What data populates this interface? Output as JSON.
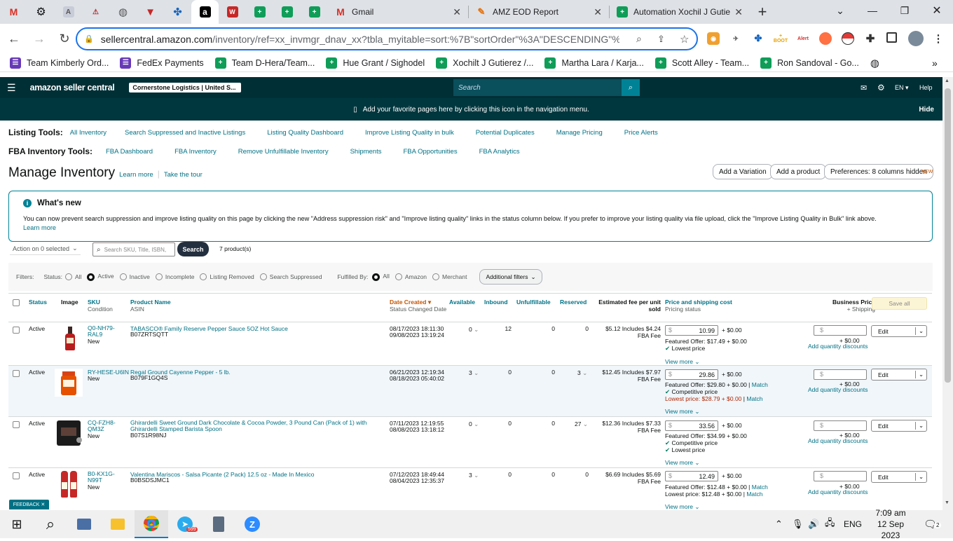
{
  "browser": {
    "pinned_tabs": [
      "gmail",
      "chatgpt",
      "ext-a",
      "ext-b",
      "globe",
      "v-shield",
      "diamond",
      "amazon",
      "wm",
      "sheets",
      "sheets",
      "sheets"
    ],
    "tabs": [
      {
        "title": "Gmail"
      },
      {
        "title": "AMZ EOD Report"
      },
      {
        "title": "Automation Xochil J Gutie"
      }
    ],
    "url": "sellercentral.amazon.com",
    "url_rest": "/inventory/ref=xx_invmgr_dnav_xx?tbla_myitable=sort:%7B\"sortOrder\"%3A\"DESCENDING\"%2C...",
    "bookmarks": [
      "Team Kimberly Ord...",
      "FedEx Payments",
      "Team D-Hera/Team...",
      "Hue Grant / Sighodel",
      "Xochilt J Gutierez /...",
      "Martha Lara / Karja...",
      "Scott Alley - Team...",
      "Ron Sandoval - Go..."
    ],
    "ext_labels": {
      "boot": "BOOT",
      "alert": "Alert"
    }
  },
  "seller": {
    "logo": "amazon seller central",
    "account": "Cornerstone Logistics | United S...",
    "search_placeholder": "Search",
    "lang": "EN",
    "help": "Help",
    "nav_hint": "Add your favorite pages here by clicking this icon in the navigation menu.",
    "hide": "Hide"
  },
  "tools": {
    "listing_label": "Listing Tools:",
    "listing": [
      "All Inventory",
      "Search Suppressed and Inactive Listings",
      "Listing Quality Dashboard",
      "Improve Listing Quality in bulk",
      "Potential Duplicates",
      "Manage Pricing",
      "Price Alerts"
    ],
    "fba_label": "FBA Inventory Tools:",
    "fba": [
      "FBA Dashboard",
      "FBA Inventory",
      "Remove Unfulfillable Inventory",
      "Shipments",
      "FBA Opportunities",
      "FBA Analytics"
    ]
  },
  "page": {
    "title": "Manage Inventory",
    "learn_more": "Learn more",
    "tour": "Take the tour",
    "add_variation": "Add a Variation",
    "add_product": "Add a product",
    "preferences": "Preferences: 8 columns hidden",
    "new_badge": "NEW"
  },
  "whats_new": {
    "title": "What's new",
    "body": "You can now prevent search suppression and improve listing quality on this page by clicking the new \"Address suppression risk\" and \"Improve listing quality\" links in the status column below. If you prefer to improve your listing quality via file upload, click the \"Improve Listing Quality in Bulk\" link above.",
    "link": "Learn more"
  },
  "actions": {
    "action_select": "Action on 0 selected",
    "search_placeholder": "Search SKU, Title, ISBN,",
    "search_btn": "Search",
    "count": "7 product(s)"
  },
  "filters": {
    "label": "Filters:",
    "status_label": "Status:",
    "status": [
      "All",
      "Active",
      "Inactive",
      "Incomplete",
      "Listing Removed",
      "Search Suppressed"
    ],
    "status_selected": "Active",
    "fulfilled_label": "Fulfilled By:",
    "fulfilled": [
      "All",
      "Amazon",
      "Merchant"
    ],
    "fulfilled_selected": "All",
    "additional": "Additional filters"
  },
  "table": {
    "headers": {
      "status": "Status",
      "image": "Image",
      "sku": "SKU",
      "sku_sub": "Condition",
      "product": "Product Name",
      "product_sub": "ASIN",
      "date": "Date Created",
      "date_sub": "Status Changed Date",
      "available": "Available",
      "inbound": "Inbound",
      "unfulfillable": "Unfulfillable",
      "reserved": "Reserved",
      "fee": "Estimated fee per unit sold",
      "price": "Price and shipping cost",
      "price_sub": "Pricing status",
      "business": "Business Price",
      "business_sub": "+ Shipping",
      "save_all": "Save all"
    },
    "rows": [
      {
        "status": "Active",
        "sku": "Q0-NH79-RAL9",
        "condition": "New",
        "name": "TABASCO® Family Reserve Pepper Sauce 5OZ Hot Sauce",
        "asin": "B07ZRTSQTT",
        "created": "08/17/2023 18:11:30",
        "changed": "09/08/2023 13:19:24",
        "available": "0",
        "inbound": "12",
        "unfulfillable": "0",
        "reserved": "0",
        "fee": "$5.12 Includes $4.24 FBA Fee",
        "price": "10.99",
        "ship": "+ $0.00",
        "offer1": "Featured Offer: $17.49 + $0.00",
        "offer1_match": "",
        "check1": "Lowest price",
        "offer2": "",
        "offer2_match": "",
        "check2": "",
        "edit": "Edit",
        "view_more": "View more",
        "add_qty": "Add quantity discounts",
        "bp_ship": "+ $0.00",
        "img": "tabasco"
      },
      {
        "status": "Active",
        "sku": "RY-HESE-U6IN",
        "condition": "New",
        "name": "Regal Ground Cayenne Pepper - 5 lb.",
        "asin": "B079F1GQ4S",
        "created": "06/21/2023 12:19:34",
        "changed": "08/18/2023 05:40:02",
        "available": "3",
        "inbound": "0",
        "unfulfillable": "0",
        "reserved": "3",
        "fee": "$12.45 Includes $7.97 FBA Fee",
        "price": "29.86",
        "ship": "+ $0.00",
        "offer1": "Featured Offer: $29.80 + $0.00",
        "offer1_match": "Match",
        "check1": "Competitive price",
        "offer2": "Lowest price: $28.79 + $0.00",
        "offer2_match": "Match",
        "check2": "",
        "edit": "Edit",
        "view_more": "View more",
        "add_qty": "Add quantity discounts",
        "bp_ship": "+ $0.00",
        "img": "cayenne"
      },
      {
        "status": "Active",
        "sku": "CQ-FZH8-QM3Z",
        "condition": "New",
        "name": "Ghirardelli Sweet Ground Dark Chocolate & Cocoa Powder, 3 Pound Can (Pack of 1) with Ghirardelli Stamped Barista Spoon",
        "asin": "B07S1R98NJ",
        "created": "07/11/2023 12:19:55",
        "changed": "08/08/2023 13:18:12",
        "available": "0",
        "inbound": "0",
        "unfulfillable": "0",
        "reserved": "27",
        "fee": "$12.36 Includes $7.33 FBA Fee",
        "price": "33.56",
        "ship": "+ $0.00",
        "offer1": "Featured Offer: $34.99 + $0.00",
        "offer1_match": "",
        "check1": "Competitive price",
        "offer2": "",
        "offer2_match": "",
        "check2": "Lowest price",
        "edit": "Edit",
        "view_more": "View more",
        "add_qty": "Add quantity discounts",
        "bp_ship": "+ $0.00",
        "img": "cocoa"
      },
      {
        "status": "Active",
        "sku": "B0-KX1G-N99T",
        "condition": "New",
        "name": "Valentina Mariscos - Salsa Picante (2 Pack) 12.5 oz - Made In Mexico",
        "asin": "B0BSDSJMC1",
        "created": "07/12/2023 18:49:44",
        "changed": "08/04/2023 12:35:37",
        "available": "3",
        "inbound": "0",
        "unfulfillable": "0",
        "reserved": "0",
        "fee": "$6.69 Includes $5.69 FBA Fee",
        "price": "12.49",
        "ship": "+ $0.00",
        "offer1": "Featured Offer: $12.48 + $0.00",
        "offer1_match": "Match",
        "check1": "",
        "offer2": "Lowest price: $12.48 + $0.00",
        "offer2_match": "Match",
        "check2": "",
        "edit": "Edit",
        "view_more": "View more",
        "add_qty": "Add quantity discounts",
        "bp_ship": "+ $0.00",
        "img": "valentina"
      }
    ]
  },
  "feedback": "FEEDBACK",
  "taskbar": {
    "lang": "ENG",
    "time": "7:09 am",
    "date": "12 Sep 2023",
    "telegram_badge": "599",
    "notif": "2"
  },
  "colors": {
    "seller_header": "#002f36",
    "teal_link": "#007185",
    "accent": "#1a73e8"
  }
}
